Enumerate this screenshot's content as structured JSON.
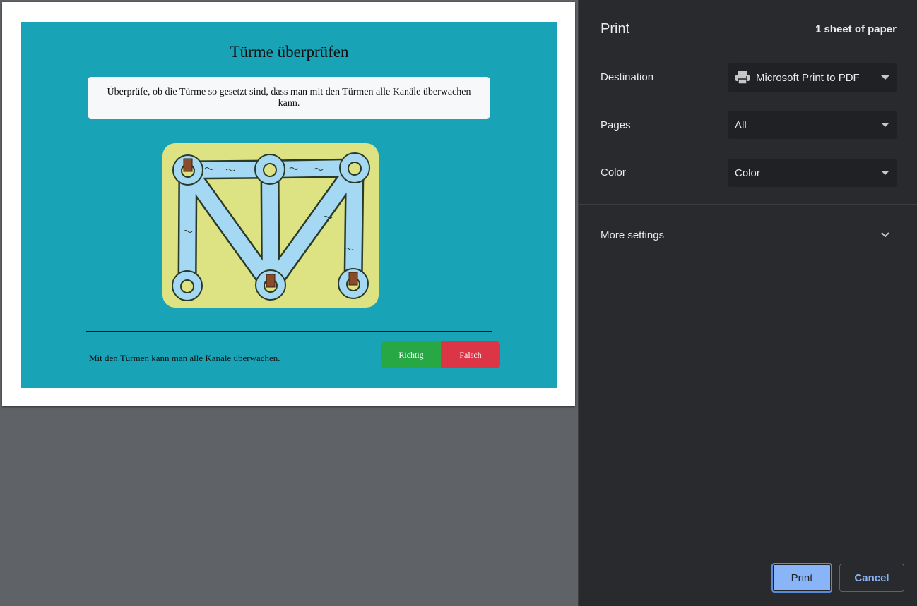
{
  "preview": {
    "title": "Türme überprüfen",
    "instruction": "Überprüfe, ob die Türme so gesetzt sind, dass man mit den Türmen alle Kanäle überwachen kann.",
    "statement": "Mit den Türmen kann man alle Kanäle überwachen.",
    "answers": {
      "richtig": "Richtig",
      "falsch": "Falsch"
    },
    "colors": {
      "sheet_bg": "#18a3b6",
      "puzzle_land": "#dde282",
      "water": "#a5d8f3",
      "richtig": "#28a745",
      "falsch": "#dc3545"
    }
  },
  "panel": {
    "title": "Print",
    "sheet_count": "1 sheet of paper",
    "destination": {
      "label": "Destination",
      "value": "Microsoft Print to PDF",
      "icon": "printer-icon"
    },
    "pages": {
      "label": "Pages",
      "value": "All"
    },
    "color": {
      "label": "Color",
      "value": "Color"
    },
    "more_settings": "More settings",
    "print_button": "Print",
    "cancel_button": "Cancel",
    "accent": "#8ab4f8"
  }
}
